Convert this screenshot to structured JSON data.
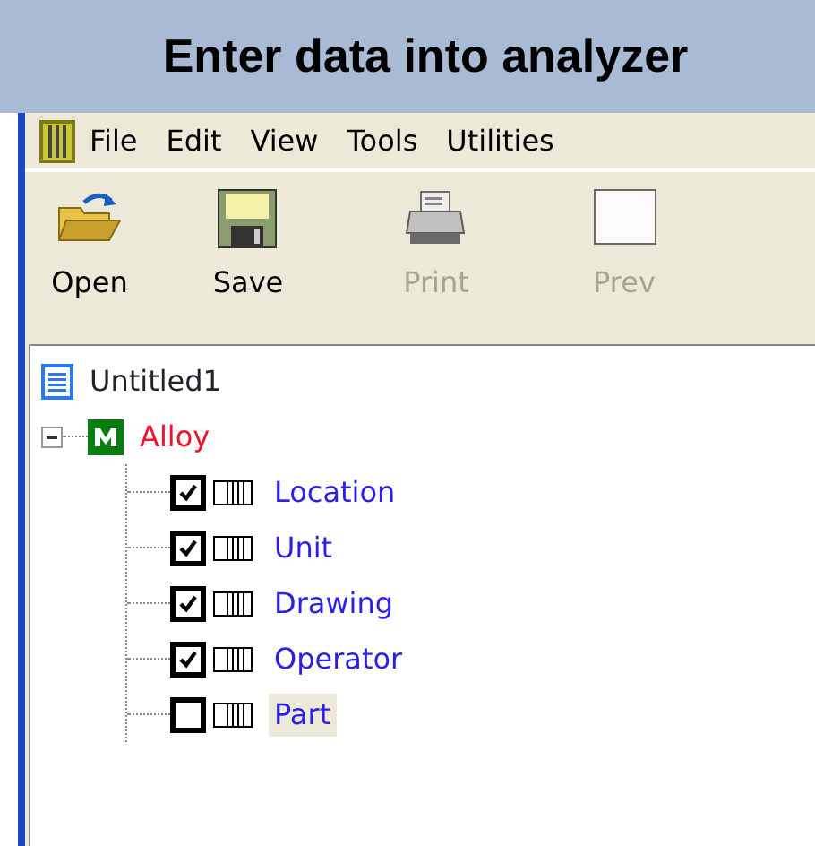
{
  "header": {
    "title": "Enter data into analyzer"
  },
  "menu": [
    "File",
    "Edit",
    "View",
    "Tools",
    "Utilities"
  ],
  "toolbar": [
    {
      "label": "Open",
      "kind": "open",
      "disabled": false
    },
    {
      "label": "Save",
      "kind": "save",
      "disabled": false
    },
    {
      "label": "Print",
      "kind": "print",
      "disabled": true
    },
    {
      "label": "Prev",
      "kind": "preview",
      "disabled": true
    }
  ],
  "tree": {
    "label": "Untitled1",
    "children": [
      {
        "label": "Alloy",
        "expanded": true,
        "children": [
          {
            "label": "Location",
            "checked": true,
            "selected": false
          },
          {
            "label": "Unit",
            "checked": true,
            "selected": false
          },
          {
            "label": "Drawing",
            "checked": true,
            "selected": false
          },
          {
            "label": "Operator",
            "checked": true,
            "selected": false
          },
          {
            "label": "Part",
            "checked": false,
            "selected": true
          }
        ]
      }
    ]
  }
}
